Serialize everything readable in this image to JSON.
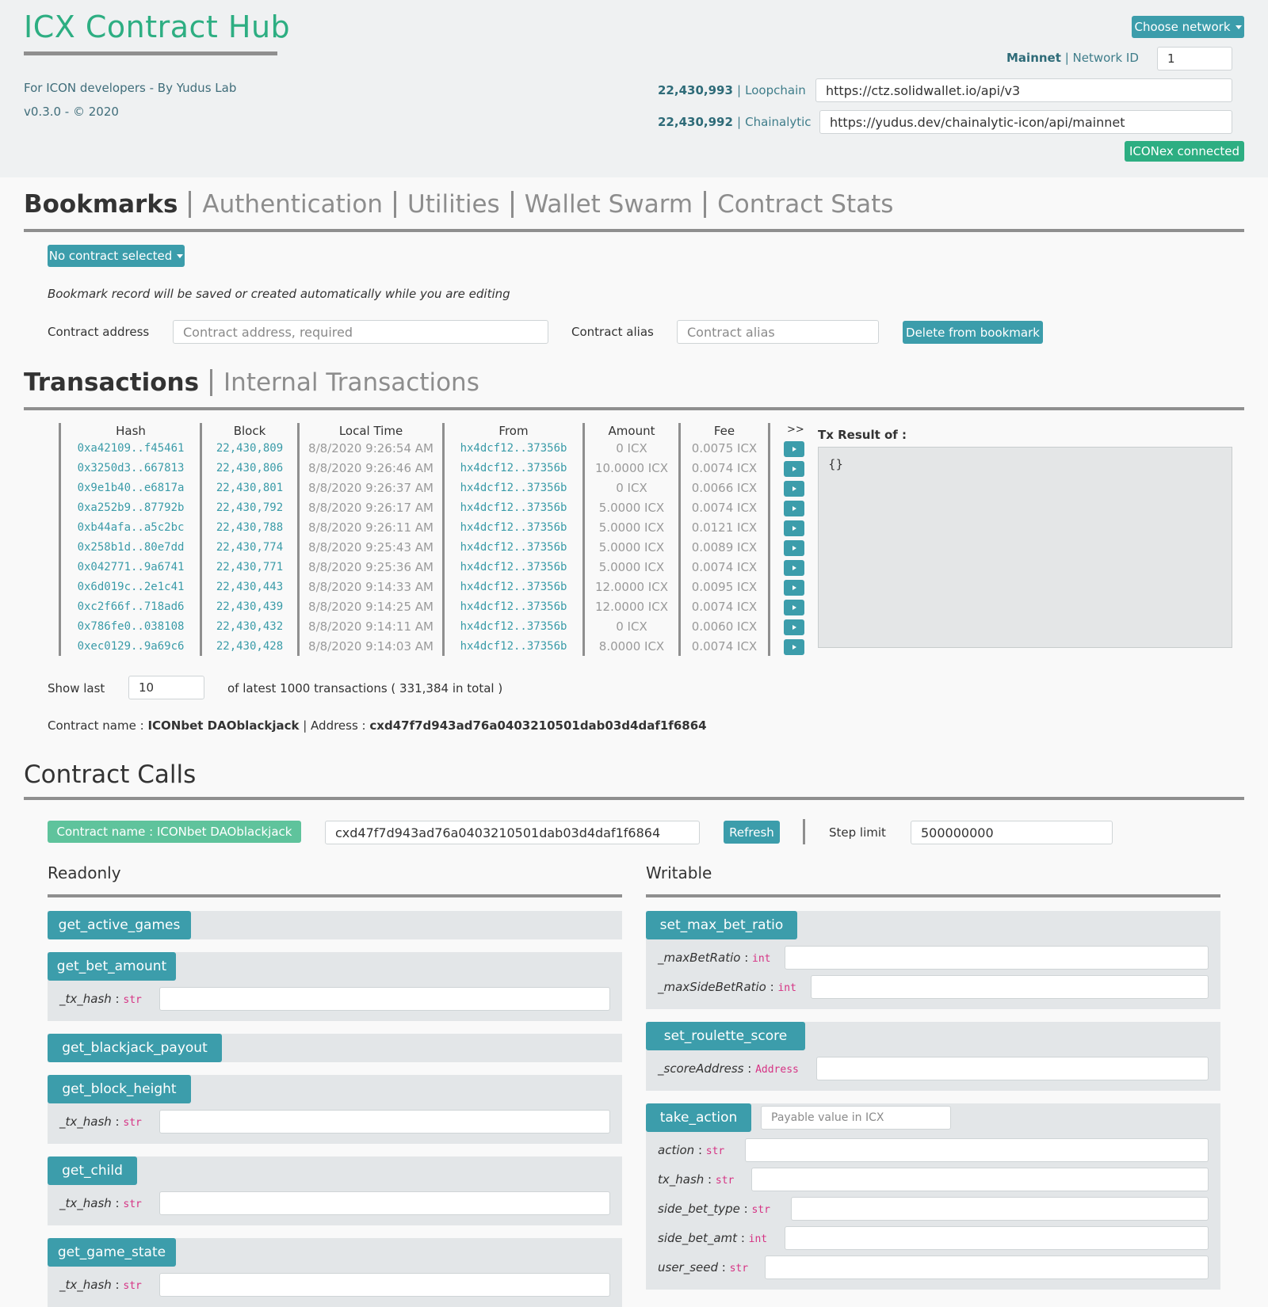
{
  "header": {
    "title": "ICX Contract Hub",
    "tagline": "For ICON developers - By Yudus Lab",
    "version": "v0.3.0 - © 2020",
    "choose_network": "Choose network",
    "network_name": "Mainnet",
    "network_id_label": "Network ID",
    "network_id_value": "1",
    "loopchain_height": "22,430,993",
    "loopchain_label": "Loopchain",
    "loopchain_url": "https://ctz.solidwallet.io/api/v3",
    "chainalytic_height": "22,430,992",
    "chainalytic_label": "Chainalytic",
    "chainalytic_url": "https://yudus.dev/chainalytic-icon/api/mainnet",
    "iconex_status": "ICONex connected"
  },
  "tabs": [
    "Bookmarks",
    "Authentication",
    "Utilities",
    "Wallet Swarm",
    "Contract Stats"
  ],
  "bookmarks": {
    "contract_dropdown": "No contract selected",
    "note": "Bookmark record will be saved or created automatically while you are editing",
    "address_label": "Contract address",
    "address_placeholder": "Contract address, required",
    "alias_label": "Contract alias",
    "alias_placeholder": "Contract alias",
    "delete_button": "Delete from bookmark"
  },
  "tx_tabs": [
    "Transactions",
    "Internal Transactions"
  ],
  "transactions": {
    "columns": [
      "Hash",
      "Block",
      "Local Time",
      "From",
      "Amount",
      "Fee",
      ">>"
    ],
    "result_label": "Tx Result of :",
    "result_value": "{}",
    "rows": [
      [
        "0xa42109..f45461",
        "22,430,809",
        "8/8/2020 9:26:54 AM",
        "hx4dcf12..37356b",
        "0 ICX",
        "0.0075 ICX"
      ],
      [
        "0x3250d3..667813",
        "22,430,806",
        "8/8/2020 9:26:46 AM",
        "hx4dcf12..37356b",
        "10.0000 ICX",
        "0.0074 ICX"
      ],
      [
        "0x9e1b40..e6817a",
        "22,430,801",
        "8/8/2020 9:26:37 AM",
        "hx4dcf12..37356b",
        "0 ICX",
        "0.0066 ICX"
      ],
      [
        "0xa252b9..87792b",
        "22,430,792",
        "8/8/2020 9:26:17 AM",
        "hx4dcf12..37356b",
        "5.0000 ICX",
        "0.0074 ICX"
      ],
      [
        "0xb44afa..a5c2bc",
        "22,430,788",
        "8/8/2020 9:26:11 AM",
        "hx4dcf12..37356b",
        "5.0000 ICX",
        "0.0121 ICX"
      ],
      [
        "0x258b1d..80e7dd",
        "22,430,774",
        "8/8/2020 9:25:43 AM",
        "hx4dcf12..37356b",
        "5.0000 ICX",
        "0.0089 ICX"
      ],
      [
        "0x042771..9a6741",
        "22,430,771",
        "8/8/2020 9:25:36 AM",
        "hx4dcf12..37356b",
        "5.0000 ICX",
        "0.0074 ICX"
      ],
      [
        "0x6d019c..2e1c41",
        "22,430,443",
        "8/8/2020 9:14:33 AM",
        "hx4dcf12..37356b",
        "12.0000 ICX",
        "0.0095 ICX"
      ],
      [
        "0xc2f66f..718ad6",
        "22,430,439",
        "8/8/2020 9:14:25 AM",
        "hx4dcf12..37356b",
        "12.0000 ICX",
        "0.0074 ICX"
      ],
      [
        "0x786fe0..038108",
        "22,430,432",
        "8/8/2020 9:14:11 AM",
        "hx4dcf12..37356b",
        "0 ICX",
        "0.0060 ICX"
      ],
      [
        "0xec0129..9a69c6",
        "22,430,428",
        "8/8/2020 9:14:03 AM",
        "hx4dcf12..37356b",
        "8.0000 ICX",
        "0.0074 ICX"
      ]
    ],
    "show_last_label": "Show last",
    "show_last_value": "10",
    "total_text": "of latest 1000 transactions ( 331,384 in total )",
    "contract_name_label": "Contract name :",
    "contract_name": "ICONbet DAOblackjack",
    "address_label": "| Address :",
    "address": "cxd47f7d943ad76a0403210501dab03d4daf1f6864"
  },
  "calls": {
    "title": "Contract Calls",
    "contract_badge_label": "Contract name : ",
    "contract_badge_name": "ICONbet DAOblackjack",
    "address": "cxd47f7d943ad76a0403210501dab03d4daf1f6864",
    "refresh": "Refresh",
    "step_limit_label": "Step limit",
    "step_limit_value": "500000000",
    "readonly_title": "Readonly",
    "writable_title": "Writable",
    "payable_placeholder": "Payable value in ICX",
    "readonly": [
      {
        "name": "get_active_games",
        "params": []
      },
      {
        "name": "get_bet_amount",
        "params": [
          {
            "name": "_tx_hash",
            "type": "str"
          }
        ]
      },
      {
        "name": "get_blackjack_payout",
        "params": []
      },
      {
        "name": "get_block_height",
        "params": [
          {
            "name": "_tx_hash",
            "type": "str"
          }
        ]
      },
      {
        "name": "get_child",
        "params": [
          {
            "name": "_tx_hash",
            "type": "str"
          }
        ]
      },
      {
        "name": "get_game_state",
        "params": [
          {
            "name": "_tx_hash",
            "type": "str"
          }
        ]
      }
    ],
    "writable": [
      {
        "name": "set_max_bet_ratio",
        "params": [
          {
            "name": "_maxBetRatio",
            "type": "int"
          },
          {
            "name": "_maxSideBetRatio",
            "type": "int"
          }
        ]
      },
      {
        "name": "set_roulette_score",
        "params": [
          {
            "name": "_scoreAddress",
            "type": "Address"
          }
        ]
      },
      {
        "name": "take_action",
        "params": [
          {
            "name": "action",
            "type": "str"
          },
          {
            "name": "tx_hash",
            "type": "str"
          },
          {
            "name": "side_bet_type",
            "type": "str"
          },
          {
            "name": "side_bet_amt",
            "type": "int"
          },
          {
            "name": "user_seed",
            "type": "str"
          }
        ]
      }
    ]
  }
}
